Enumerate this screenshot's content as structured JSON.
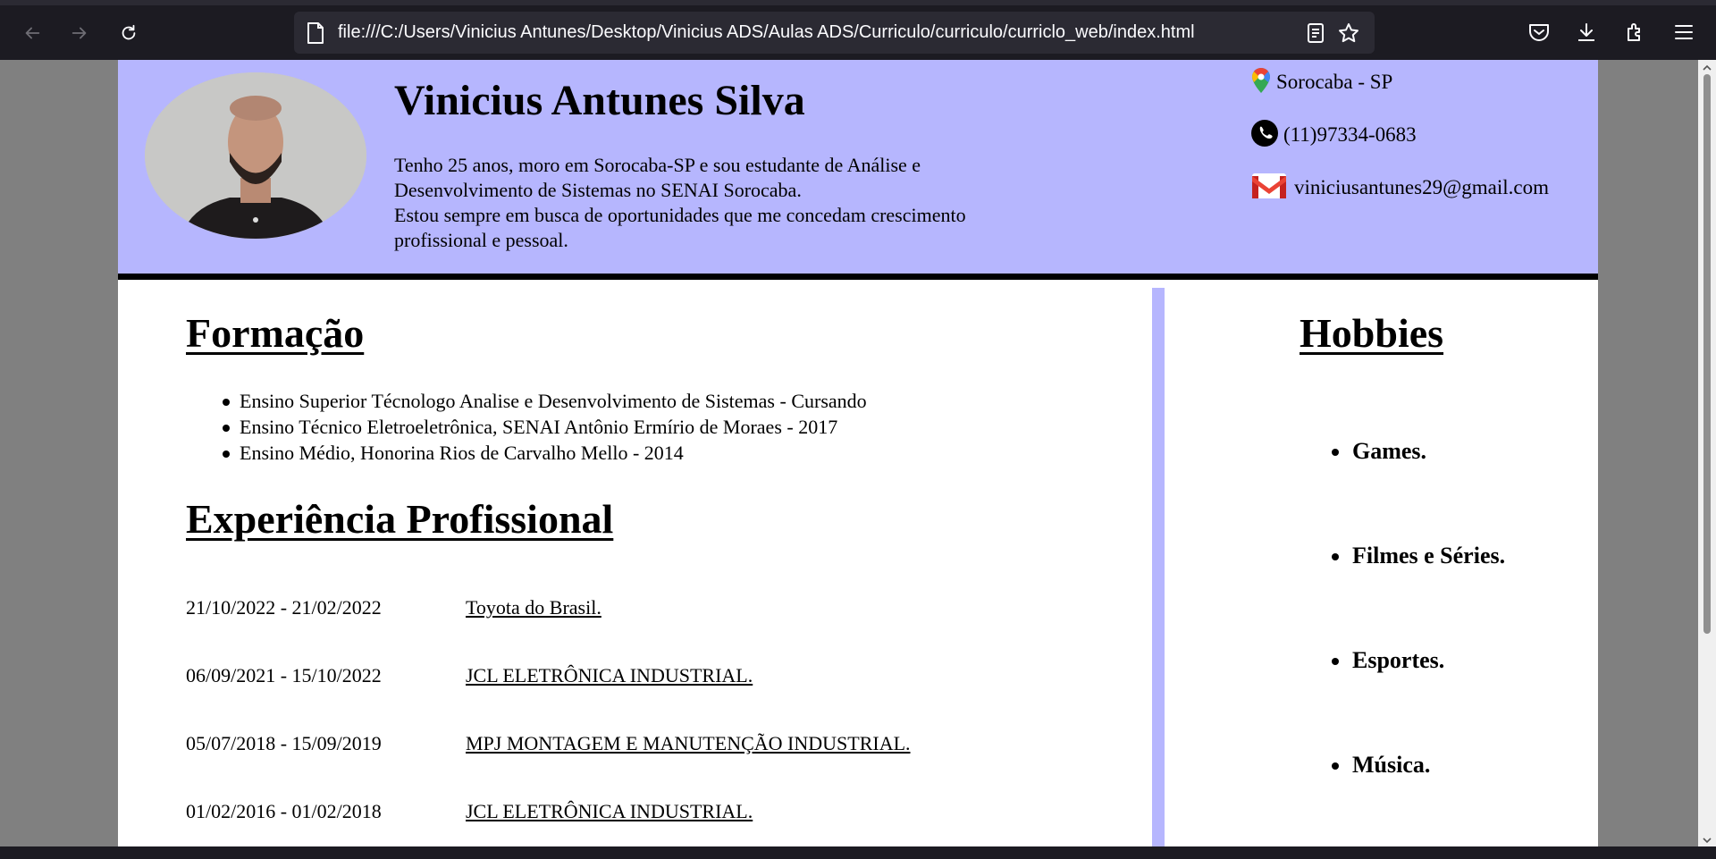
{
  "browser": {
    "url": "file:///C:/Users/Vinicius Antunes/Desktop/Vinicius ADS/Aulas ADS/Curriculo/curriculo/curriclo_web/index.html",
    "icons": [
      "back-icon",
      "forward-icon",
      "reload-icon",
      "page-icon",
      "reader-mode-icon",
      "bookmark-star-icon",
      "pocket-icon",
      "downloads-icon",
      "extensions-icon",
      "menu-icon"
    ]
  },
  "header": {
    "name": "Vinicius Antunes Silva",
    "bio": [
      "Tenho 25 anos, moro em Sorocaba-SP e sou estudante de Análise e Desenvolvimento de Sistemas no SENAI Sorocaba.",
      "Estou sempre em busca de oportunidades que me concedam crescimento profissional e pessoal."
    ],
    "contact": {
      "location": "Sorocaba - SP",
      "phone": "(11)97334-0683",
      "email": "viniciusantunes29@gmail.com"
    }
  },
  "education": {
    "title": "Formação",
    "items": [
      "Ensino Superior Técnologo Analise e Desenvolvimento de Sistemas - Cursando",
      "Ensino Técnico Eletroeletrônica, SENAI Antônio Ermírio de Moraes - 2017",
      "Ensino Médio, Honorina Rios de Carvalho Mello - 2014"
    ]
  },
  "experience": {
    "title": "Experiência Profissional",
    "items": [
      {
        "dates": "21/10/2022 - 21/02/2022",
        "company": "Toyota do Brasil."
      },
      {
        "dates": "06/09/2021 - 15/10/2022",
        "company": "JCL ELETRÔNICA INDUSTRIAL."
      },
      {
        "dates": "05/07/2018 - 15/09/2019",
        "company": "MPJ MONTAGEM E MANUTENÇÃO INDUSTRIAL."
      },
      {
        "dates": "01/02/2016 - 01/02/2018",
        "company": "JCL ELETRÔNICA INDUSTRIAL."
      }
    ]
  },
  "hobbies": {
    "title": "Hobbies",
    "items": [
      "Games.",
      "Filmes e Séries.",
      "Esportes.",
      "Música."
    ]
  },
  "colors": {
    "header_bg": "#b6b6fe",
    "chrome_bg": "#1c1b22",
    "urlbar_bg": "#2b2a33"
  }
}
